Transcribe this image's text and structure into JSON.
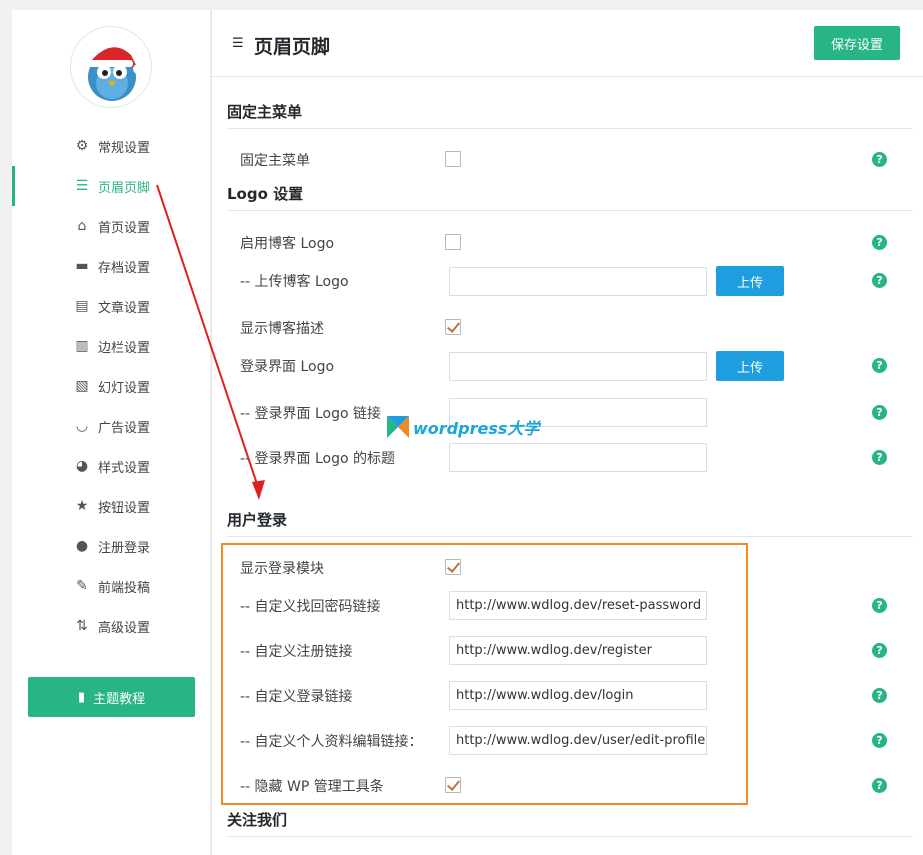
{
  "colors": {
    "accent": "#27b585",
    "upload": "#1e9ddf",
    "highlight": "#f08a24",
    "arrow": "#e0201f",
    "check": "#c4713b"
  },
  "sidebar": {
    "items": [
      {
        "label": "常规设置",
        "icon": "gear-icon"
      },
      {
        "label": "页眉页脚",
        "icon": "header-footer-icon",
        "active": true
      },
      {
        "label": "首页设置",
        "icon": "home-icon"
      },
      {
        "label": "存档设置",
        "icon": "folder-icon"
      },
      {
        "label": "文章设置",
        "icon": "document-icon"
      },
      {
        "label": "边栏设置",
        "icon": "sidebar-icon"
      },
      {
        "label": "幻灯设置",
        "icon": "slides-icon"
      },
      {
        "label": "广告设置",
        "icon": "smile-icon"
      },
      {
        "label": "样式设置",
        "icon": "palette-icon"
      },
      {
        "label": "按钮设置",
        "icon": "star-icon"
      },
      {
        "label": "注册登录",
        "icon": "user-icon"
      },
      {
        "label": "前端投稿",
        "icon": "pencil-icon"
      },
      {
        "label": "高级设置",
        "icon": "sliders-icon"
      }
    ],
    "tutorial_label": "主题教程"
  },
  "header": {
    "title": "页眉页脚",
    "save_label": "保存设置"
  },
  "sections": {
    "fixed_menu": {
      "title": "固定主菜单",
      "row_label": "固定主菜单",
      "checked": false
    },
    "logo": {
      "title": "Logo 设置",
      "enable_label": "启用博客 Logo",
      "enable_checked": false,
      "upload_label": "-- 上传博客 Logo",
      "upload_value": "",
      "upload_button": "上传",
      "show_desc_label": "显示博客描述",
      "show_desc_checked": true,
      "login_logo_label": "登录界面 Logo",
      "login_logo_value": "",
      "login_logo_button": "上传",
      "login_logo_link_label": "-- 登录界面 Logo 链接",
      "login_logo_link_value": "",
      "login_logo_title_label": "-- 登录界面 Logo 的标题",
      "login_logo_title_value": ""
    },
    "user_login": {
      "title": "用户登录",
      "show_module_label": "显示登录模块",
      "show_module_checked": true,
      "reset_label": "-- 自定义找回密码链接",
      "reset_value": "http://www.wdlog.dev/reset-password",
      "register_label": "-- 自定义注册链接",
      "register_value": "http://www.wdlog.dev/register",
      "login_label": "-- 自定义登录链接",
      "login_value": "http://www.wdlog.dev/login",
      "profile_label": "-- 自定义个人资料编辑链接：",
      "profile_value": "http://www.wdlog.dev/user/edit-profile",
      "hide_toolbar_label": "-- 隐藏 WP 管理工具条",
      "hide_toolbar_checked": true
    },
    "follow": {
      "title": "关注我们"
    }
  },
  "help_glyph": "?",
  "watermark": {
    "text": "wordpress大学",
    "icon": "wordpress-daxue-logo-icon"
  }
}
